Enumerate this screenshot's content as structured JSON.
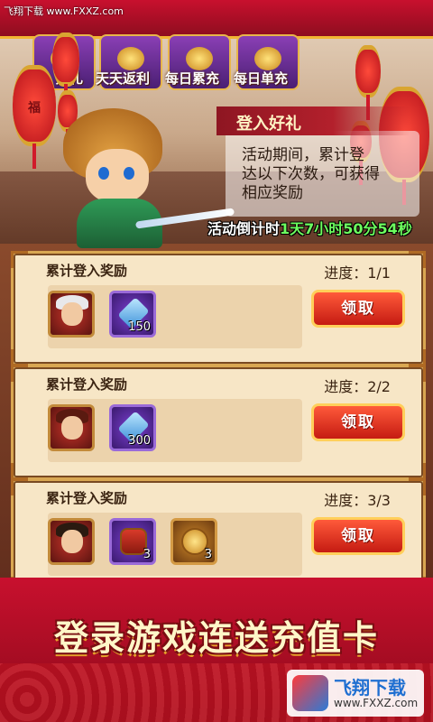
{
  "watermark_top": "飞翔下载 www.FXXZ.com",
  "tabs": [
    {
      "label": "好礼"
    },
    {
      "label": "天天返利"
    },
    {
      "label": "每日累充"
    },
    {
      "label": "每日单充"
    }
  ],
  "lantern_char": "福",
  "event": {
    "title": "登入好礼",
    "description": "活动期间，累计登\n达以下次数，可获得\n相应奖励",
    "countdown_label": "活动倒计时",
    "countdown_value": "1天7小时50分54秒"
  },
  "rewards": [
    {
      "title": "累计登入奖励",
      "progress": "进度：1/1",
      "items": [
        {
          "icon": "hero-portrait-icon",
          "count": ""
        },
        {
          "icon": "crystal-icon",
          "count": "150"
        }
      ],
      "button": "领取"
    },
    {
      "title": "累计登入奖励",
      "progress": "进度：2/2",
      "items": [
        {
          "icon": "hero-portrait-icon",
          "count": ""
        },
        {
          "icon": "crystal-icon",
          "count": "300"
        }
      ],
      "button": "领取"
    },
    {
      "title": "累计登入奖励",
      "progress": "进度：3/3",
      "items": [
        {
          "icon": "hero-portrait-icon",
          "count": ""
        },
        {
          "icon": "treasure-chest-icon",
          "count": "3"
        },
        {
          "icon": "gold-coin-icon",
          "count": "3"
        }
      ],
      "button": "领取"
    }
  ],
  "promo_text": "登录游戏连送充值卡",
  "logo": {
    "title": "飞翔下载",
    "url": "www.FXXZ.com"
  }
}
